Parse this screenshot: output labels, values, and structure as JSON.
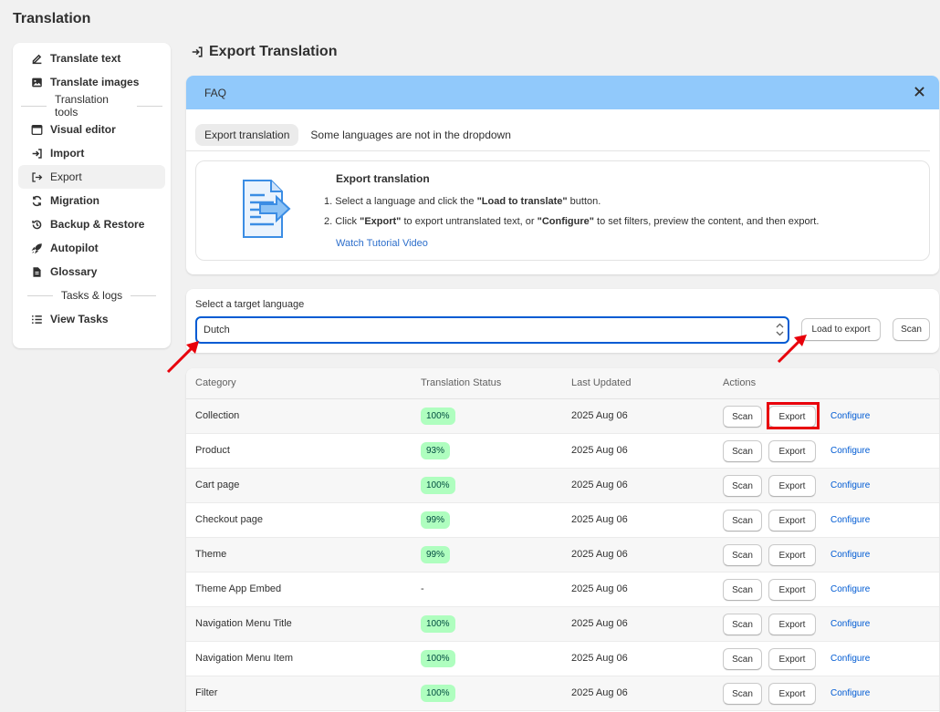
{
  "app": {
    "title": "Translation"
  },
  "sidebar": {
    "items_top": [
      {
        "label": "Translate text",
        "icon": "edit-icon"
      },
      {
        "label": "Translate images",
        "icon": "image-icon"
      }
    ],
    "section1": "Translation tools",
    "items_tools": [
      {
        "label": "Visual editor",
        "icon": "browser-icon"
      },
      {
        "label": "Import",
        "icon": "import-icon"
      },
      {
        "label": "Export",
        "icon": "export-icon",
        "active": true
      },
      {
        "label": "Migration",
        "icon": "refresh-icon"
      },
      {
        "label": "Backup & Restore",
        "icon": "history-icon"
      },
      {
        "label": "Autopilot",
        "icon": "rocket-icon"
      },
      {
        "label": "Glossary",
        "icon": "file-icon"
      }
    ],
    "section2": "Tasks & logs",
    "items_tasks": [
      {
        "label": "View Tasks",
        "icon": "list-icon"
      }
    ]
  },
  "main": {
    "title": "Export Translation",
    "faq": {
      "header": "FAQ",
      "tabs": [
        "Export translation",
        "Some languages are not in the dropdown"
      ],
      "content_title": "Export translation",
      "step1_prefix": "1. Select a language and click the ",
      "step1_bold": "\"Load to translate\"",
      "step1_suffix": " button.",
      "step2_prefix": "2. Click ",
      "step2_bold1": "\"Export\"",
      "step2_mid": " to export untranslated text, or ",
      "step2_bold2": "\"Configure\"",
      "step2_suffix": " to set filters, preview the content, and then export.",
      "video_link": "Watch Tutorial Video"
    },
    "language": {
      "label": "Select a target language",
      "selected": "Dutch",
      "load_button": "Load to export",
      "scan_button": "Scan"
    },
    "table": {
      "headers": [
        "Category",
        "Translation Status",
        "Last Updated",
        "Actions"
      ],
      "rows": [
        {
          "category": "Collection",
          "status": "100%",
          "updated": "2025 Aug 06"
        },
        {
          "category": "Product",
          "status": "93%",
          "updated": "2025 Aug 06"
        },
        {
          "category": "Cart page",
          "status": "100%",
          "updated": "2025 Aug 06"
        },
        {
          "category": "Checkout page",
          "status": "99%",
          "updated": "2025 Aug 06"
        },
        {
          "category": "Theme",
          "status": "99%",
          "updated": "2025 Aug 06"
        },
        {
          "category": "Theme App Embed",
          "status": "-",
          "updated": "2025 Aug 06"
        },
        {
          "category": "Navigation Menu Title",
          "status": "100%",
          "updated": "2025 Aug 06"
        },
        {
          "category": "Navigation Menu Item",
          "status": "100%",
          "updated": "2025 Aug 06"
        },
        {
          "category": "Filter",
          "status": "100%",
          "updated": "2025 Aug 06"
        }
      ],
      "scan_label": "Scan",
      "export_label": "Export",
      "configure_label": "Configure"
    }
  },
  "colors": {
    "faq_header": "#91c9fb",
    "badge_bg": "#affebf",
    "link": "#005bd3",
    "annotation_red": "#e8000b"
  }
}
